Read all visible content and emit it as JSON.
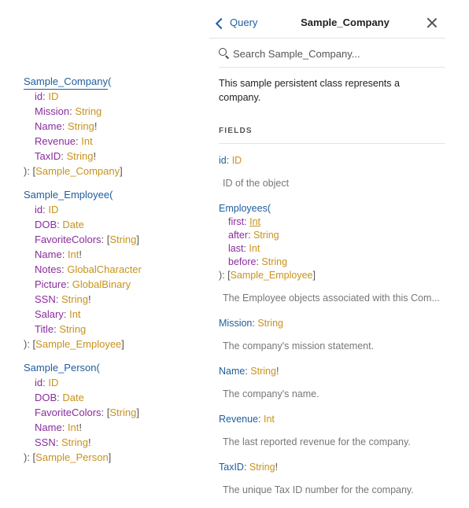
{
  "schema": {
    "types": [
      {
        "name": "Sample_Company",
        "active": true,
        "fields": [
          {
            "name": "id",
            "type": "ID",
            "bang": false,
            "list": false
          },
          {
            "name": "Mission",
            "type": "String",
            "bang": false,
            "list": false
          },
          {
            "name": "Name",
            "type": "String",
            "bang": true,
            "list": false
          },
          {
            "name": "Revenue",
            "type": "Int",
            "bang": false,
            "list": false
          },
          {
            "name": "TaxID",
            "type": "String",
            "bang": true,
            "list": false
          }
        ],
        "returns": "Sample_Company"
      },
      {
        "name": "Sample_Employee",
        "active": false,
        "fields": [
          {
            "name": "id",
            "type": "ID",
            "bang": false,
            "list": false
          },
          {
            "name": "DOB",
            "type": "Date",
            "bang": false,
            "list": false
          },
          {
            "name": "FavoriteColors",
            "type": "String",
            "bang": false,
            "list": true
          },
          {
            "name": "Name",
            "type": "Int",
            "bang": true,
            "list": false
          },
          {
            "name": "Notes",
            "type": "GlobalCharacter",
            "bang": false,
            "list": false
          },
          {
            "name": "Picture",
            "type": "GlobalBinary",
            "bang": false,
            "list": false
          },
          {
            "name": "SSN",
            "type": "String",
            "bang": true,
            "list": false
          },
          {
            "name": "Salary",
            "type": "Int",
            "bang": false,
            "list": false
          },
          {
            "name": "Title",
            "type": "String",
            "bang": false,
            "list": false
          }
        ],
        "returns": "Sample_Employee"
      },
      {
        "name": "Sample_Person",
        "active": false,
        "fields": [
          {
            "name": "id",
            "type": "ID",
            "bang": false,
            "list": false
          },
          {
            "name": "DOB",
            "type": "Date",
            "bang": false,
            "list": false
          },
          {
            "name": "FavoriteColors",
            "type": "String",
            "bang": false,
            "list": true
          },
          {
            "name": "Name",
            "type": "Int",
            "bang": true,
            "list": false
          },
          {
            "name": "SSN",
            "type": "String",
            "bang": true,
            "list": false
          }
        ],
        "returns": "Sample_Person"
      }
    ]
  },
  "panel": {
    "back_label": "Query",
    "title": "Sample_Company",
    "search_placeholder": "Search Sample_Company...",
    "description": "This sample persistent class represents a company.",
    "fields_heading": "FIELDS",
    "fields": [
      {
        "name": "id",
        "type": "ID",
        "bang": false,
        "args": [],
        "returns_list": "",
        "desc": "ID of the object"
      },
      {
        "name": "Employees",
        "type": "",
        "bang": false,
        "args": [
          {
            "name": "first",
            "type": "Int",
            "link": true
          },
          {
            "name": "after",
            "type": "String",
            "link": false
          },
          {
            "name": "last",
            "type": "Int",
            "link": false
          },
          {
            "name": "before",
            "type": "String",
            "link": false
          }
        ],
        "returns_list": "Sample_Employee",
        "desc": "The Employee objects associated with this Com..."
      },
      {
        "name": "Mission",
        "type": "String",
        "bang": false,
        "args": [],
        "returns_list": "",
        "desc": "The company's mission statement."
      },
      {
        "name": "Name",
        "type": "String",
        "bang": true,
        "args": [],
        "returns_list": "",
        "desc": "The company's name."
      },
      {
        "name": "Revenue",
        "type": "Int",
        "bang": false,
        "args": [],
        "returns_list": "",
        "desc": "The last reported revenue for the company."
      },
      {
        "name": "TaxID",
        "type": "String",
        "bang": true,
        "args": [],
        "returns_list": "",
        "desc": "The unique Tax ID number for the company."
      }
    ]
  },
  "colors": {
    "type_name": "#1f5d9c",
    "field_name": "#8a2c9e",
    "type_ref": "#c8921b",
    "muted": "#777777"
  }
}
